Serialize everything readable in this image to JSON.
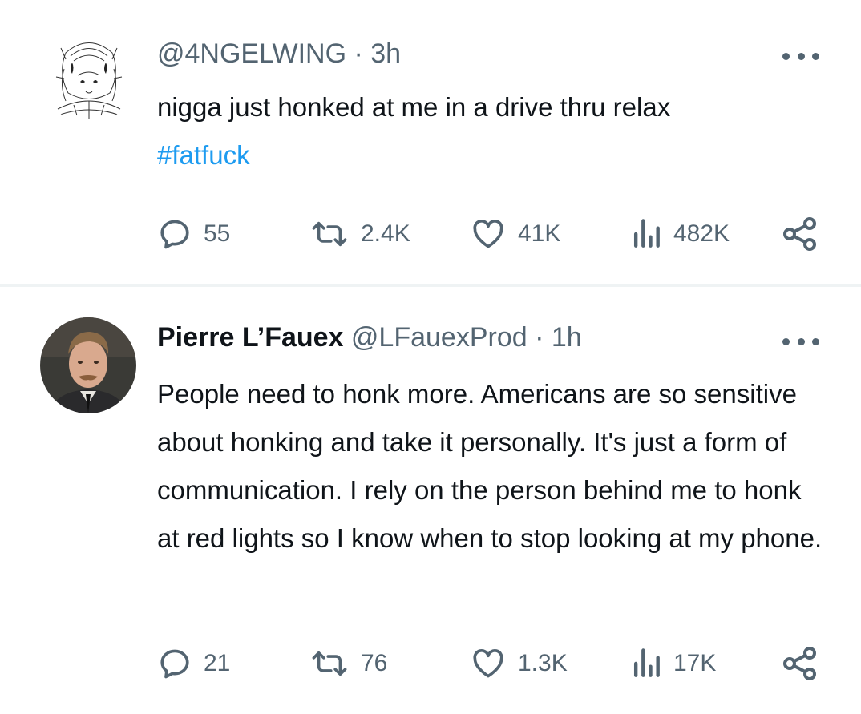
{
  "tweets": [
    {
      "handle": "@4NGELWING",
      "time": "3h",
      "text": "nigga just honked at me in a drive thru relax",
      "hashtag": "#fatfuck",
      "replies": "55",
      "retweets": "2.4K",
      "likes": "41K",
      "views": "482K"
    },
    {
      "name": "Pierre L’Fauex",
      "handle": "@LFauexProd",
      "time": "1h",
      "text": "People need to honk more. Americans are so sensitive about honking and take it personally. It's just a form of communication. I rely on the person behind me to honk at red lights so I know when to stop looking at my phone.",
      "replies": "21",
      "retweets": "76",
      "likes": "1.3K",
      "views": "17K"
    }
  ],
  "separator": " · ",
  "colors": {
    "text": "#0f1419",
    "secondary": "#536471",
    "link": "#1d9bf0",
    "divider": "#eff3f4"
  }
}
